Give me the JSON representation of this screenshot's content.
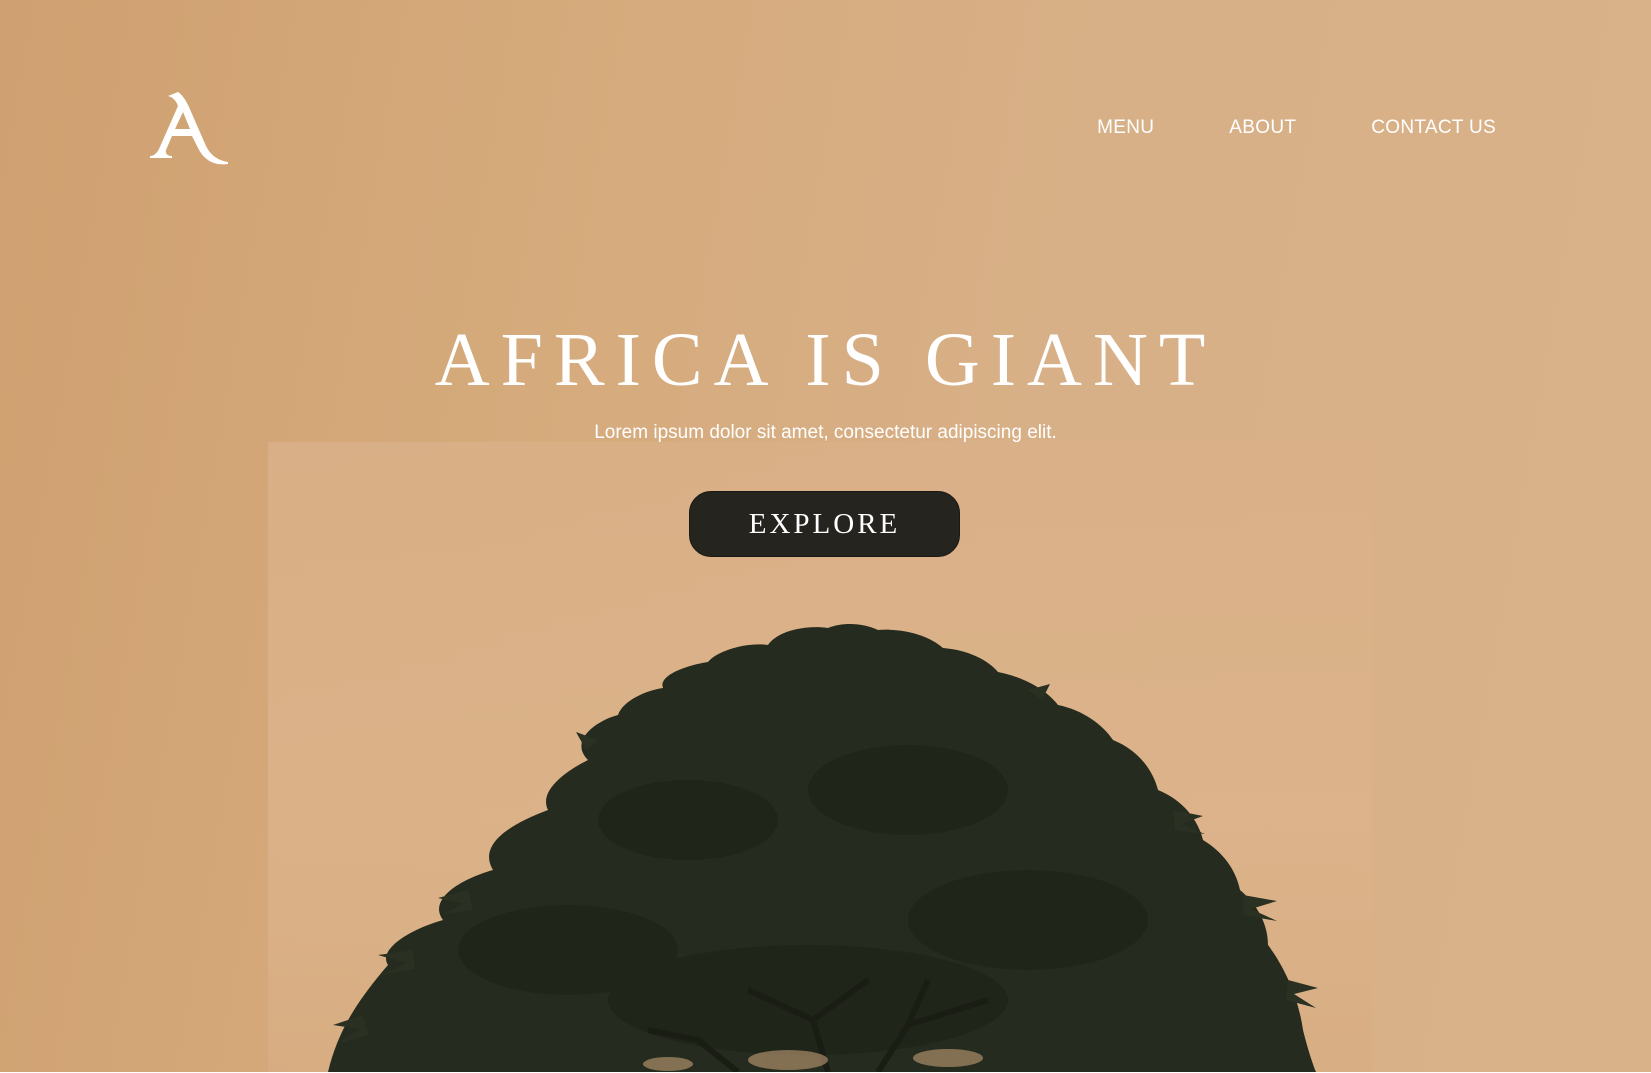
{
  "header": {
    "logo_letter": "A",
    "nav": [
      {
        "label": "MENU"
      },
      {
        "label": "ABOUT"
      },
      {
        "label": "CONTACT US"
      }
    ]
  },
  "hero": {
    "title": "AFRICA IS GIANT",
    "subtitle": "Lorem ipsum dolor sit amet, consectetur adipiscing elit.",
    "cta_label": "EXPLORE"
  },
  "colors": {
    "background": "#d5aa7b",
    "button": "#25241f",
    "tree": "#252b1e",
    "text": "#ffffff"
  }
}
